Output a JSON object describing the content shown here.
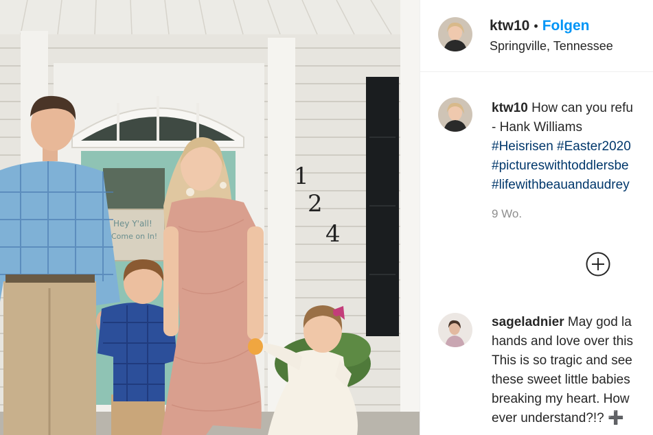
{
  "post": {
    "house_number": [
      "1",
      "2",
      "4"
    ],
    "door_sign": [
      "Hey Y'all!",
      "Come on In!"
    ]
  },
  "header": {
    "username": "ktw10",
    "separator": "•",
    "follow_label": "Folgen",
    "location": "Springville, Tennessee"
  },
  "caption": {
    "username": "ktw10",
    "text_line1": "How can you refu",
    "text_line2": "- Hank Williams",
    "hashtags": [
      "#Heisrisen #Easter2020",
      "#pictureswithtoddlersbe",
      "#lifewithbeauandaudrey"
    ]
  },
  "timestamp": "9 Wo.",
  "load_more_icon": "plus-circle-icon",
  "comment": {
    "username": "sageladnier",
    "lines": [
      "May god la",
      "hands and love over this",
      "This is so tragic and see",
      "these sweet little babies",
      "breaking my heart. How",
      "ever understand?!? ➕"
    ]
  },
  "colors": {
    "follow": "#0095f6",
    "hashtag": "#00376b",
    "muted": "#8e8e8e"
  }
}
